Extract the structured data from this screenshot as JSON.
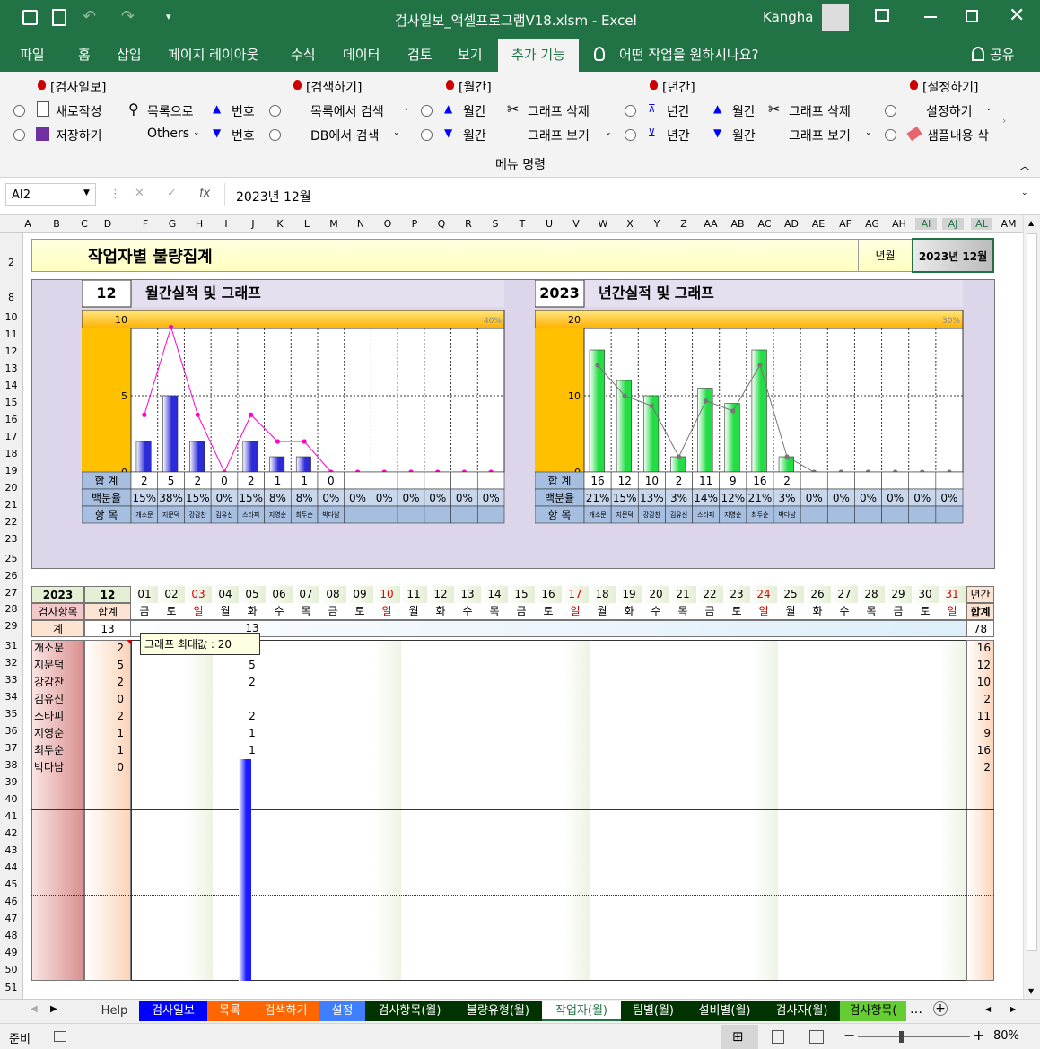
{
  "window": {
    "title": "검사일보_액셀프로그램V18.xlsm  -  Excel",
    "user": "Kangha"
  },
  "tabs": [
    "파일",
    "홈",
    "삽입",
    "페이지 레이아웃",
    "수식",
    "데이터",
    "검토",
    "보기",
    "추가 기능"
  ],
  "tellme": "어떤 작업을 원하시나요?",
  "share": "공유",
  "ribbon": {
    "g1": {
      "title": "[검사일보]",
      "new": "새로작성",
      "save": "저장하기",
      "list": "목록으로",
      "others": "Others",
      "num_up": "번호",
      "num_down": "번호"
    },
    "g2": {
      "title": "[검색하기]",
      "search_list": "목록에서 검색",
      "search_db": "DB에서 검색"
    },
    "g3": {
      "title": "[월간]",
      "month_up": "월간",
      "month_down": "월간",
      "graph_del": "그래프 삭제",
      "graph_view": "그래프 보기"
    },
    "g4": {
      "title": "[년간]",
      "year_up": "년간",
      "year_down": "년간",
      "month_up": "월간",
      "month_down": "월간",
      "graph_del": "그래프 삭제",
      "graph_view": "그래프 보기"
    },
    "g5": {
      "title": "[설정하기]",
      "settings": "설정하기",
      "sample": "샘플내용 삭"
    },
    "footer": "메뉴 명령"
  },
  "formula": {
    "namebox": "AI2",
    "fx": "fx",
    "value": "2023년 12월"
  },
  "columns": [
    "A",
    "B",
    "C",
    "D",
    "F",
    "G",
    "H",
    "I",
    "J",
    "K",
    "L",
    "M",
    "N",
    "O",
    "P",
    "Q",
    "R",
    "S",
    "T",
    "U",
    "V",
    "W",
    "X",
    "Y",
    "Z",
    "AA",
    "AB",
    "AC",
    "AD",
    "AE",
    "AF",
    "AG",
    "AH",
    "AI",
    "AJ",
    "AL",
    "AM"
  ],
  "rows": [
    "2",
    "8",
    "10",
    "11",
    "12",
    "13",
    "14",
    "15",
    "16",
    "17",
    "18",
    "19",
    "20",
    "21",
    "22",
    "23",
    "25",
    "26",
    "27",
    "28",
    "29",
    "31",
    "32",
    "33",
    "34",
    "35",
    "36",
    "37",
    "38",
    "39",
    "40",
    "41",
    "42",
    "43",
    "44",
    "45",
    "46",
    "47",
    "48",
    "49",
    "50",
    "51"
  ],
  "sheet": {
    "title": "작업자별 불량집계",
    "ym_label": "년월",
    "ym_value": "2023년 12월",
    "month_num": "12",
    "month_title": "월간실적 및 그래프",
    "year_num": "2023",
    "year_title": "년간실적 및 그래프",
    "row_total": "합 계",
    "row_pct": "백분율",
    "row_item": "항 목",
    "tooltip": "그래프 최대값 : 20",
    "year_cell": "2023",
    "month_cell": "12",
    "item_hdr": "검사항목",
    "sum_hdr": "합계",
    "total_lbl": "계",
    "total_val": "13",
    "day5_total": "13",
    "annual_hdr": "년간",
    "annual_sum_hdr": "합계",
    "annual_total": "78",
    "days": [
      "01",
      "02",
      "03",
      "04",
      "05",
      "06",
      "07",
      "08",
      "09",
      "10",
      "11",
      "12",
      "13",
      "14",
      "15",
      "16",
      "17",
      "18",
      "19",
      "20",
      "21",
      "22",
      "23",
      "24",
      "25",
      "26",
      "27",
      "28",
      "29",
      "30",
      "31"
    ],
    "weekdays": [
      "금",
      "토",
      "일",
      "월",
      "화",
      "수",
      "목",
      "금",
      "토",
      "일",
      "월",
      "화",
      "수",
      "목",
      "금",
      "토",
      "일",
      "월",
      "화",
      "수",
      "목",
      "금",
      "토",
      "일",
      "월",
      "화",
      "수",
      "목",
      "금",
      "토",
      "일"
    ],
    "workers": [
      {
        "name": "개소문",
        "sum": "2",
        "d5": "2",
        "annual": "16"
      },
      {
        "name": "지문덕",
        "sum": "5",
        "d5": "5",
        "annual": "12"
      },
      {
        "name": "강감찬",
        "sum": "2",
        "d5": "2",
        "annual": "10"
      },
      {
        "name": "김유신",
        "sum": "0",
        "d5": "",
        "annual": "2"
      },
      {
        "name": "스타피",
        "sum": "2",
        "d5": "2",
        "annual": "11"
      },
      {
        "name": "지영순",
        "sum": "1",
        "d5": "1",
        "annual": "9"
      },
      {
        "name": "최두순",
        "sum": "1",
        "d5": "1",
        "annual": "16"
      },
      {
        "name": "박다남",
        "sum": "0",
        "d5": "",
        "annual": "2"
      }
    ]
  },
  "chart_data": [
    {
      "type": "bar",
      "title": "월간실적 및 그래프",
      "categories": [
        "개소문",
        "지문덕",
        "강감찬",
        "김유신",
        "스타피",
        "지영순",
        "최두순",
        "박다남",
        "",
        "",
        "",
        "",
        "",
        ""
      ],
      "series": [
        {
          "values": [
            2,
            5,
            2,
            0,
            2,
            1,
            1,
            0,
            0,
            0,
            0,
            0,
            0,
            0
          ]
        }
      ],
      "line_pct": [
        15,
        38,
        15,
        0,
        15,
        8,
        8,
        0,
        0,
        0,
        0,
        0,
        0,
        0
      ],
      "pct_labels": [
        "15%",
        "38%",
        "15%",
        "0%",
        "15%",
        "8%",
        "8%",
        "0%",
        "0%",
        "0%",
        "0%",
        "0%",
        "0%",
        "0%"
      ],
      "total_labels": [
        "2",
        "5",
        "2",
        "0",
        "2",
        "1",
        "1",
        "0",
        "",
        "",
        "",
        "",
        "",
        ""
      ],
      "ylim": [
        0,
        10
      ],
      "yticks": [
        "0",
        "5",
        "10"
      ],
      "pct_max": "40%",
      "colors": {
        "bar": "#2b2bd8",
        "line": "#ff00cc",
        "axis": "#ffc000"
      }
    },
    {
      "type": "bar",
      "title": "년간실적 및 그래프",
      "categories": [
        "개소문",
        "지문덕",
        "강감찬",
        "김유신",
        "스타피",
        "지영순",
        "최두순",
        "박다남",
        "",
        "",
        "",
        "",
        "",
        ""
      ],
      "series": [
        {
          "values": [
            16,
            12,
            10,
            2,
            11,
            9,
            16,
            2,
            0,
            0,
            0,
            0,
            0,
            0
          ]
        }
      ],
      "line_pct": [
        21,
        15,
        13,
        3,
        14,
        12,
        21,
        3,
        0,
        0,
        0,
        0,
        0,
        0
      ],
      "pct_labels": [
        "21%",
        "15%",
        "13%",
        "3%",
        "14%",
        "12%",
        "21%",
        "3%",
        "0%",
        "0%",
        "0%",
        "0%",
        "0%",
        "0%"
      ],
      "total_labels": [
        "16",
        "12",
        "10",
        "2",
        "11",
        "9",
        "16",
        "2",
        "",
        "",
        "",
        "",
        "",
        ""
      ],
      "ylim": [
        0,
        20
      ],
      "yticks": [
        "0",
        "10",
        "20"
      ],
      "pct_max": "30%",
      "colors": {
        "bar": "#22dd44",
        "line": "#777777",
        "axis": "#ffc000"
      }
    },
    {
      "type": "bar",
      "title": "",
      "categories": [
        "05"
      ],
      "series": [
        {
          "values": [
            13
          ]
        }
      ],
      "ylim": [
        0,
        20
      ]
    }
  ],
  "sheet_tabs": [
    {
      "label": "Help",
      "bg": "#f0f0f0",
      "fg": "#333"
    },
    {
      "label": "검사일보",
      "bg": "#0000ff",
      "fg": "#fff"
    },
    {
      "label": "목록",
      "bg": "#ff6600",
      "fg": "#fff"
    },
    {
      "label": "검색하기",
      "bg": "#ff6600",
      "fg": "#fff"
    },
    {
      "label": "설정",
      "bg": "#3f7fff",
      "fg": "#fff"
    },
    {
      "label": "검사항목(월)",
      "bg": "#003300",
      "fg": "#fff"
    },
    {
      "label": "불량유형(월)",
      "bg": "#003300",
      "fg": "#fff"
    },
    {
      "label": "작업자(월)",
      "bg": "#ffffff",
      "fg": "#217346"
    },
    {
      "label": "팀별(월)",
      "bg": "#003300",
      "fg": "#fff"
    },
    {
      "label": "설비별(월)",
      "bg": "#003300",
      "fg": "#fff"
    },
    {
      "label": "검사자(월)",
      "bg": "#003300",
      "fg": "#fff"
    },
    {
      "label": "검사항목(",
      "bg": "#66cc33",
      "fg": "#000"
    }
  ],
  "status": {
    "ready": "준비",
    "zoom": "80%"
  }
}
